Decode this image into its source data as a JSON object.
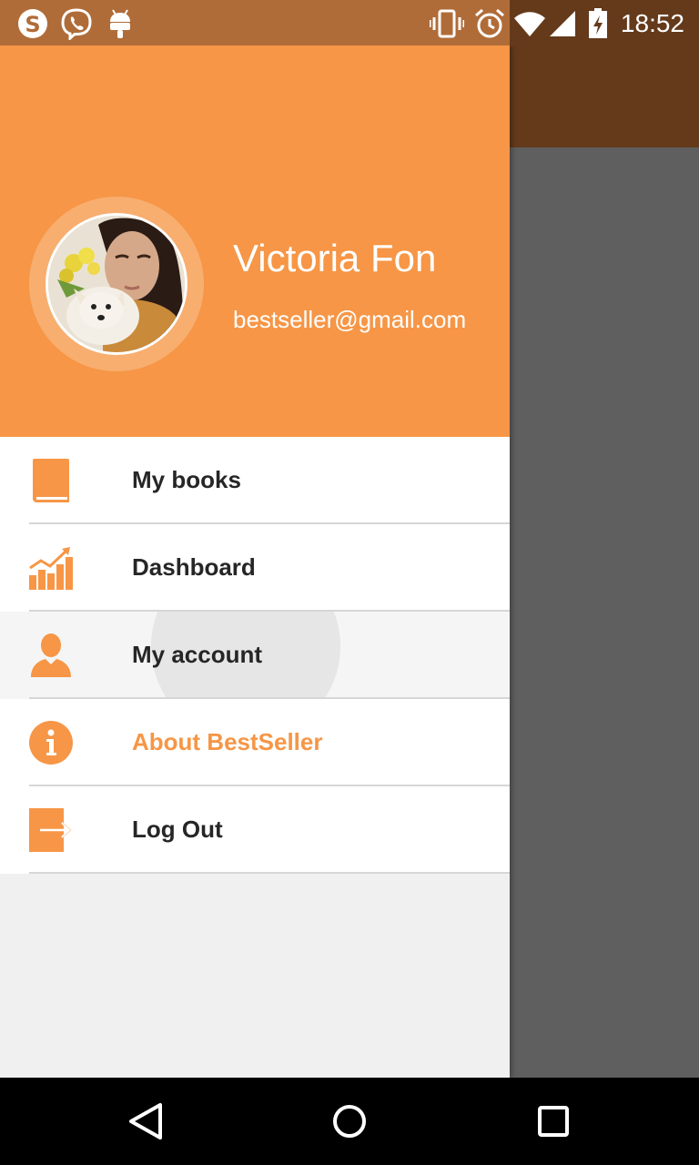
{
  "status_bar": {
    "time": "18:52",
    "left_icons": [
      "skype-icon",
      "viber-icon",
      "android-icon"
    ],
    "right_icons": [
      "vibrate-icon",
      "alarm-icon",
      "wifi-icon",
      "signal-icon",
      "battery-charging-icon"
    ]
  },
  "drawer": {
    "user": {
      "name": "Victoria Fon",
      "email": "bestseller@gmail.com"
    },
    "items": [
      {
        "label": "My books",
        "icon": "book-icon"
      },
      {
        "label": "Dashboard",
        "icon": "chart-icon"
      },
      {
        "label": "My account",
        "icon": "person-icon"
      },
      {
        "label": "About BestSeller",
        "icon": "info-icon"
      },
      {
        "label": "Log Out",
        "icon": "logout-icon"
      }
    ]
  },
  "nav_bar": {
    "buttons": [
      "back-icon",
      "home-icon",
      "recents-icon"
    ]
  },
  "colors": {
    "accent": "#f69646",
    "status_bar": "#b06c38",
    "toolbar_dimmed": "#643a1b",
    "scrim": "#5f5f5f"
  }
}
